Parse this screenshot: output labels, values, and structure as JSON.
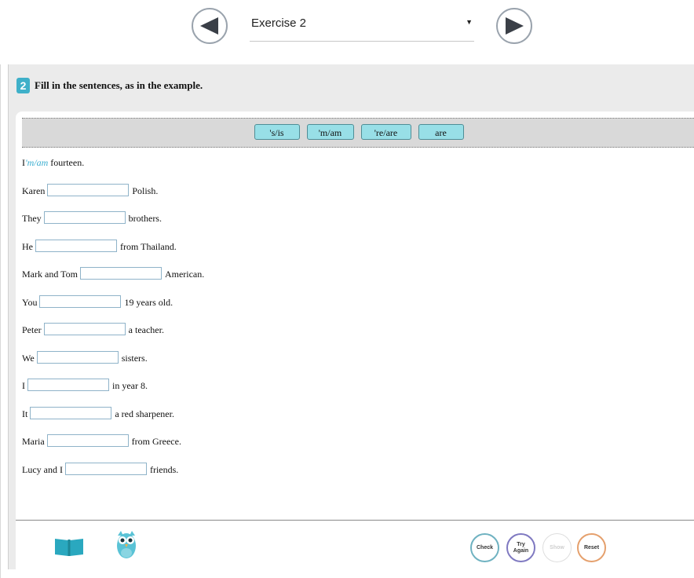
{
  "nav": {
    "exercise_select": "Exercise 2",
    "prev_icon": "triangle-left-icon",
    "next_icon": "triangle-right-icon"
  },
  "exercise": {
    "number": "2",
    "instruction": "Fill in the sentences, as in the example."
  },
  "word_bank": [
    "'s/is",
    "'m/am",
    "'re/are",
    "are"
  ],
  "example": {
    "before": "I",
    "answer": "'m/am",
    "after": "fourteen."
  },
  "sentences": [
    {
      "before": "Karen",
      "after": "Polish."
    },
    {
      "before": "They",
      "after": "brothers."
    },
    {
      "before": "He",
      "after": "from Thailand."
    },
    {
      "before": "Mark and Tom",
      "after": "American."
    },
    {
      "before": "You",
      "after": "19 years old."
    },
    {
      "before": "Peter",
      "after": "a teacher."
    },
    {
      "before": "We",
      "after": "sisters."
    },
    {
      "before": "I",
      "after": "in year 8."
    },
    {
      "before": "It",
      "after": "a red sharpener."
    },
    {
      "before": "Maria",
      "after": "from Greece."
    },
    {
      "before": "Lucy and I",
      "after": "friends."
    }
  ],
  "footer": {
    "book_icon": "book-icon",
    "owl_icon": "owl-icon",
    "check": "Check",
    "try_again": "Try\nAgain",
    "show": "Show",
    "reset": "Reset"
  },
  "colors": {
    "accent": "#3fb0c9",
    "chip": "#98dfe7",
    "example_answer": "#3aaed0",
    "panel": "#ebebeb"
  }
}
